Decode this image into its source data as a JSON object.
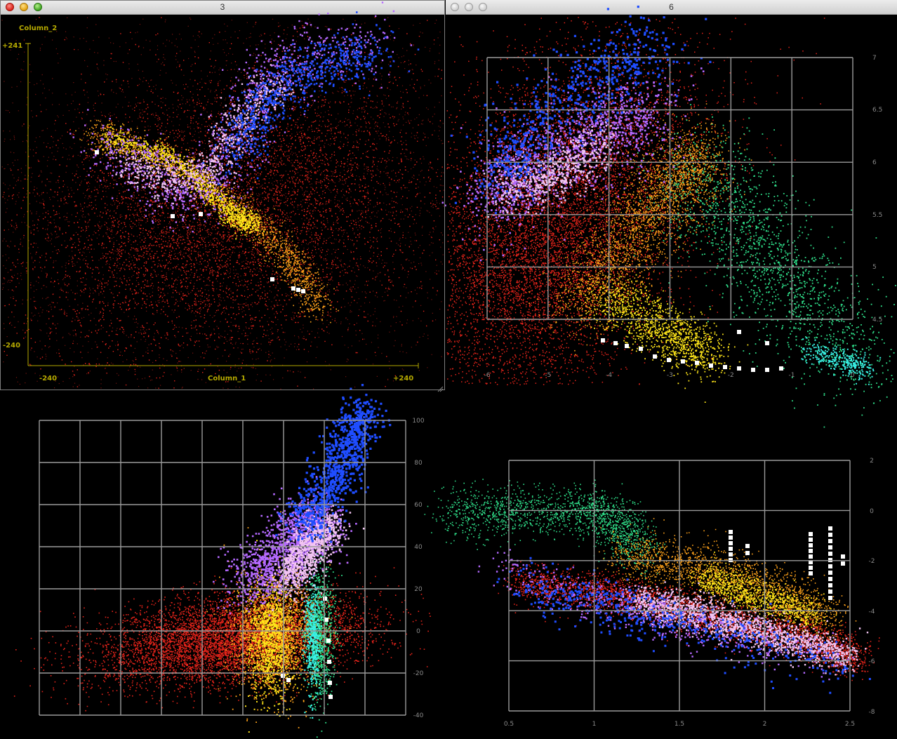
{
  "windows": [
    {
      "id": "w3",
      "title": "3"
    },
    {
      "id": "w6",
      "title": "6"
    }
  ],
  "colors": {
    "axis_yellow": "#b5a900",
    "red": "#e5231a",
    "orange": "#ffa21a",
    "yellow": "#ffe619",
    "blue": "#1f4dff",
    "violet": "#b469ff",
    "pink": "#f2c4f2",
    "green": "#2fe08a",
    "cyan": "#38f0e4",
    "white": "#ffffff",
    "grid": "#9a9a9a"
  },
  "plot_tl": {
    "y_axis_name": "Column_2",
    "x_axis_name": "Column_1",
    "y_max_label": "+241",
    "y_min_label": "-240",
    "x_min_label": "-240",
    "x_max_label": "+240"
  },
  "plot_tr": {
    "y_ticks": [
      "7",
      "6.5",
      "6",
      "5.5",
      "5",
      "4.5"
    ],
    "x_ticks": [
      "-6",
      "-5",
      "-4",
      "-3",
      "-2",
      "-1",
      "0"
    ]
  },
  "plot_bl": {
    "y_ticks": [
      "100",
      "80",
      "60",
      "40",
      "20",
      "0",
      "-20",
      "-40"
    ]
  },
  "plot_br": {
    "y_ticks": [
      "2",
      "0",
      "-2",
      "-4",
      "-6",
      "-8"
    ],
    "x_ticks": [
      "0.5",
      "1",
      "1.5",
      "2",
      "2.5"
    ]
  },
  "chart_data": [
    {
      "type": "scatter",
      "xlabel": "Column_1",
      "ylabel": "Column_2",
      "xlim": [
        -240,
        240
      ],
      "ylim": [
        -240,
        241
      ],
      "grid": false
    },
    {
      "type": "scatter",
      "xlim": [
        -6,
        0
      ],
      "ylim": [
        4.5,
        7
      ],
      "grid": true
    },
    {
      "type": "scatter",
      "ylim": [
        -40,
        100
      ],
      "grid": true
    },
    {
      "type": "scatter",
      "xlim": [
        0.5,
        2.5
      ],
      "ylim": [
        -8,
        2
      ],
      "grid": true
    }
  ]
}
